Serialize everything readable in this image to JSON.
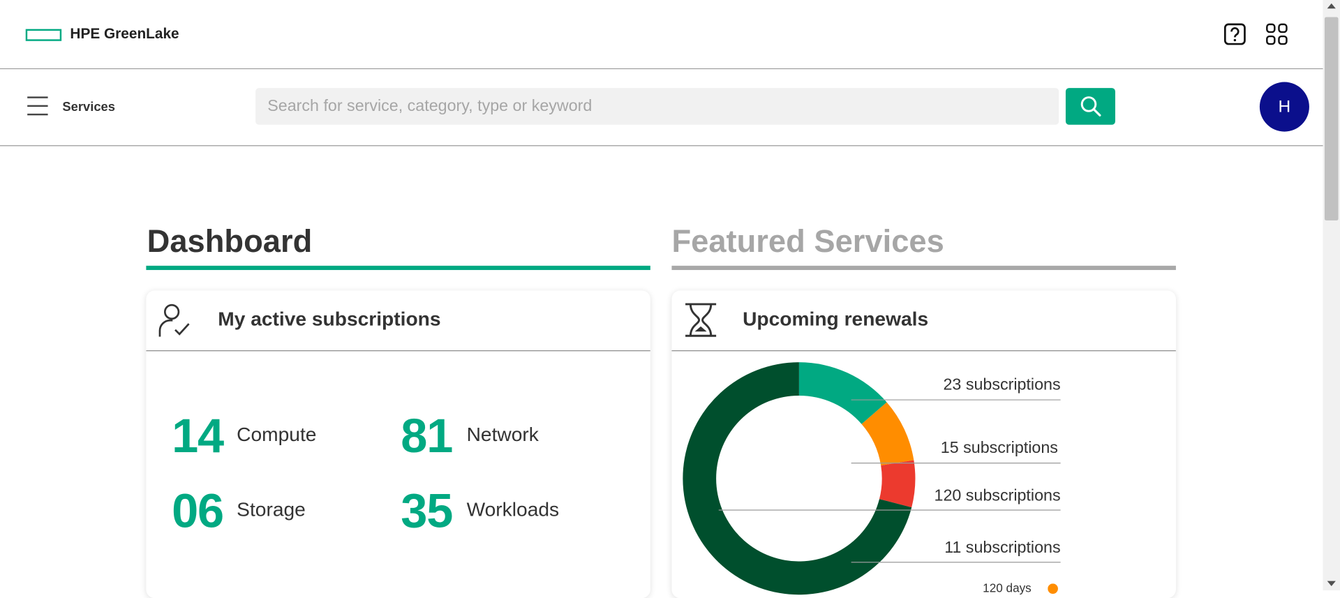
{
  "header": {
    "brand": "HPE GreenLake",
    "brand_color": "#01a982",
    "help_icon": "question-icon",
    "apps_icon": "grid-icon"
  },
  "nav": {
    "menu_icon": "hamburger-icon",
    "services_label": "Services",
    "search_placeholder": "Search for service, category, type or keyword",
    "search_icon": "search-icon",
    "avatar_initial": "H",
    "avatar_color": "#0b0f8c"
  },
  "tabs": [
    {
      "label": "Dashboard",
      "active": true
    },
    {
      "label": "Featured Services",
      "active": false
    }
  ],
  "subscriptions_card": {
    "title": "My active subscriptions",
    "icon": "user-check-icon",
    "stats": [
      {
        "value": "14",
        "label": "Compute"
      },
      {
        "value": "81",
        "label": "Network"
      },
      {
        "value": "06",
        "label": "Storage"
      },
      {
        "value": "35",
        "label": "Workloads"
      }
    ]
  },
  "renewals_card": {
    "title": "Upcoming renewals",
    "icon": "hourglass-icon",
    "callouts": [
      "23 subscriptions",
      "15 subscriptions",
      "120 subscriptions",
      "11 subscriptions"
    ],
    "legend_partial": "120 days"
  },
  "chart_data": {
    "type": "pie",
    "values": [
      23,
      15,
      11,
      120
    ],
    "labels": [
      "23 subscriptions",
      "15 subscriptions",
      "11 subscriptions",
      "120 subscriptions"
    ],
    "colors": [
      "#01a982",
      "#ff8d00",
      "#ec3a2e",
      "#004f2d"
    ]
  }
}
